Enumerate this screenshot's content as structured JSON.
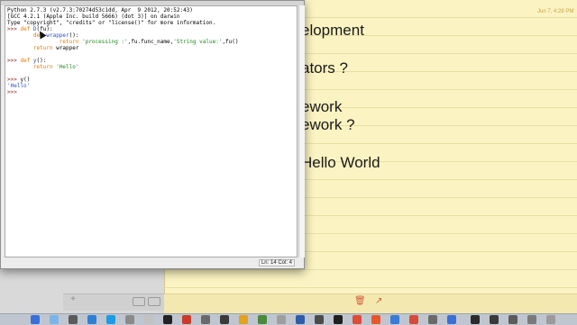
{
  "notes": {
    "date": "Jun 7, 4:28 PM",
    "lines": [
      "elopment",
      "ators ?",
      "ework",
      "ework ?",
      "Hello World"
    ]
  },
  "idle": {
    "lines": [
      [
        {
          "t": "Python 2.7.3 (v2.7.3:70274d53c1dd, Apr  9 2012, 20:52:43)",
          "c": "out"
        }
      ],
      [
        {
          "t": "[GCC 4.2.1 (Apple Inc. build 5666) (dot 3)] on darwin",
          "c": "out"
        }
      ],
      [
        {
          "t": "Type \"copyright\", \"credits\" or \"license()\" for more information.",
          "c": "out"
        }
      ],
      [
        {
          "t": ">>> ",
          "c": "prompt"
        },
        {
          "t": "def ",
          "c": "kw"
        },
        {
          "t": "D",
          "c": "fn"
        },
        {
          "t": "(fu):",
          "c": "out"
        }
      ],
      [
        {
          "t": "        ",
          "c": "out"
        },
        {
          "t": "def ",
          "c": "kw"
        },
        {
          "t": "wrapper",
          "c": "fn"
        },
        {
          "t": "():",
          "c": "out"
        }
      ],
      [
        {
          "t": "                ",
          "c": "out"
        },
        {
          "t": "return ",
          "c": "kw"
        },
        {
          "t": "'processing :'",
          "c": "str"
        },
        {
          "t": ",fu.func_name,",
          "c": "out"
        },
        {
          "t": "'String value:'",
          "c": "str"
        },
        {
          "t": ",fu()",
          "c": "out"
        }
      ],
      [
        {
          "t": "        ",
          "c": "out"
        },
        {
          "t": "return ",
          "c": "kw"
        },
        {
          "t": "wrapper",
          "c": "out"
        }
      ],
      [
        {
          "t": "",
          "c": "out"
        }
      ],
      [
        {
          "t": ">>> ",
          "c": "prompt"
        },
        {
          "t": "def ",
          "c": "kw"
        },
        {
          "t": "y",
          "c": "fn"
        },
        {
          "t": "():",
          "c": "out"
        }
      ],
      [
        {
          "t": "        ",
          "c": "out"
        },
        {
          "t": "return ",
          "c": "kw"
        },
        {
          "t": "'Hello'",
          "c": "str"
        }
      ],
      [
        {
          "t": "",
          "c": "out"
        }
      ],
      [
        {
          "t": ">>> ",
          "c": "prompt"
        },
        {
          "t": "y()",
          "c": "out"
        }
      ],
      [
        {
          "t": "'Hello'",
          "c": "res"
        }
      ],
      [
        {
          "t": ">>> ",
          "c": "prompt"
        }
      ]
    ],
    "status": "Ln: 14  Col: 4"
  },
  "icons": {
    "notes_add": "plus-icon",
    "trash": "trash-icon",
    "share": "share-icon"
  },
  "colors": {
    "prompt": "#8c1b1b",
    "keyword": "#e07b00",
    "function": "#2a4fbf",
    "string": "#1f8a1f",
    "notes_paper": "#fbf3c1"
  }
}
